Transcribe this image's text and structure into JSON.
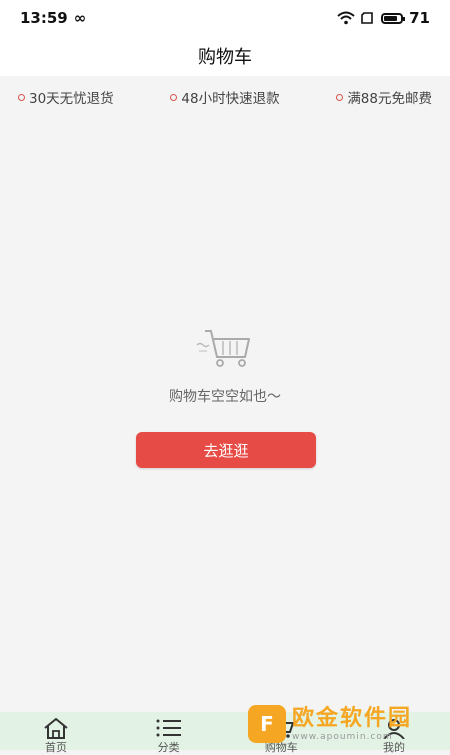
{
  "status": {
    "time": "13:59",
    "battery": "71"
  },
  "header": {
    "title": "购物车"
  },
  "promos": [
    {
      "label": "30天无忧退货"
    },
    {
      "label": "48小时快速退款"
    },
    {
      "label": "满88元免邮费"
    }
  ],
  "empty": {
    "message": "购物车空空如也～",
    "button_label": "去逛逛"
  },
  "tabs": [
    {
      "label": "首页",
      "icon": "home-icon"
    },
    {
      "label": "分类",
      "icon": "list-icon"
    },
    {
      "label": "购物车",
      "icon": "cart-icon"
    },
    {
      "label": "我的",
      "icon": "user-icon"
    }
  ],
  "watermark": {
    "name": "欧金软件园",
    "url": "www.apoumin.com"
  },
  "colors": {
    "accent": "#e64b45",
    "tabbar": "#e2f3e6",
    "watermark": "#f5a623"
  }
}
